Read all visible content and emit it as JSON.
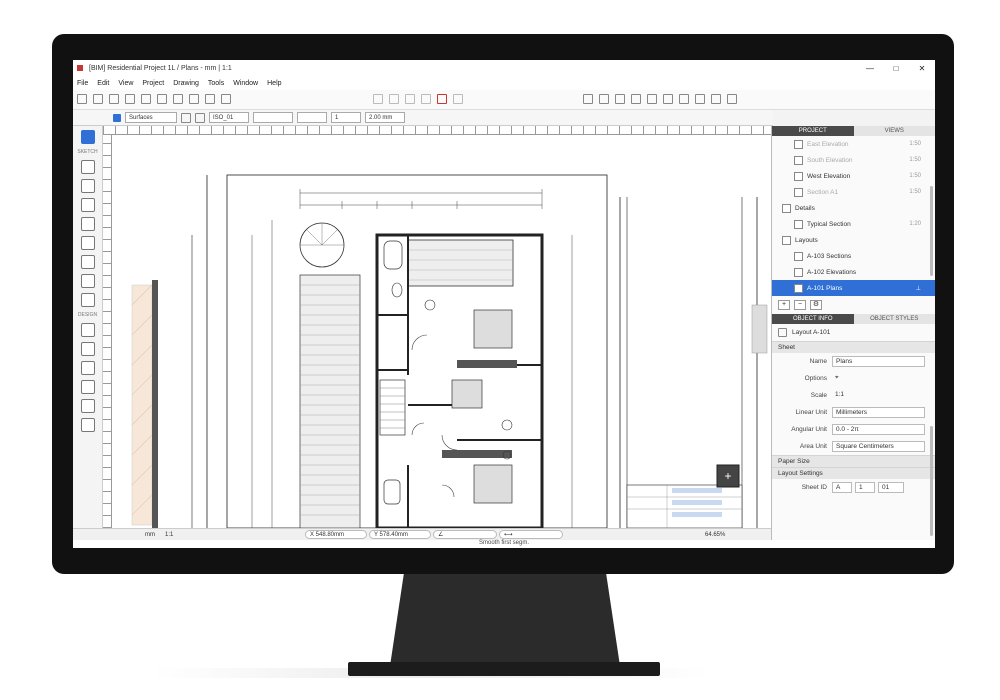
{
  "window": {
    "title": "[BIM] Residential Project 1L / Plans - mm | 1:1",
    "controls": [
      "—",
      "□",
      "✕"
    ]
  },
  "menu": [
    "File",
    "Edit",
    "View",
    "Project",
    "Drawing",
    "Tools",
    "Window",
    "Help"
  ],
  "toolbar": {
    "layer_select": "Surfaces",
    "style_select": "ISO_01",
    "line_weight": "1",
    "line_width": "2.00 mm"
  },
  "left_tools": {
    "section_sketch": "SKETCH",
    "section_design": "DESIGN"
  },
  "panel": {
    "tabs": [
      "PROJECT",
      "VIEWS"
    ],
    "tree": [
      {
        "label": "East Elevation",
        "scale": "1:50",
        "dim": true
      },
      {
        "label": "South Elevation",
        "scale": "1:50",
        "dim": true
      },
      {
        "label": "West Elevation",
        "scale": "1:50",
        "dim": false
      },
      {
        "label": "Section A1",
        "scale": "1:50",
        "dim": true
      },
      {
        "label": "Details",
        "scale": "",
        "group": true
      },
      {
        "label": "Typical Section",
        "scale": "1:20",
        "dim": false
      },
      {
        "label": "Layouts",
        "scale": "",
        "group": true
      },
      {
        "label": "A-103 Sections",
        "scale": "",
        "dim": false
      },
      {
        "label": "A-102 Elevations",
        "scale": "",
        "dim": false
      },
      {
        "label": "A-101 Plans",
        "scale": "",
        "selected": true
      }
    ],
    "buttons": [
      "+",
      "−",
      "⚙"
    ],
    "sub_tabs": [
      "OBJECT INFO",
      "OBJECT STYLES"
    ],
    "object_title": "Layout A-101",
    "sheet_section": "Sheet",
    "fields": [
      {
        "label": "Name",
        "value": "Plans",
        "input": true
      },
      {
        "label": "Options",
        "value": "⌖",
        "input": false
      },
      {
        "label": "Scale",
        "value": "1:1",
        "input": false
      },
      {
        "label": "Linear Unit",
        "value": "Millimeters",
        "input": true
      },
      {
        "label": "Angular Unit",
        "value": "0.0 - 2π",
        "input": true
      },
      {
        "label": "Area Unit",
        "value": "Square Centimeters",
        "input": true
      }
    ],
    "paper_size": "Paper Size",
    "layout_settings": "Layout Settings",
    "sheet_id_label": "Sheet ID",
    "sheet_id_values": [
      "A",
      "1",
      "01"
    ]
  },
  "status": {
    "snap": "mm",
    "scale": "1:1",
    "x": "X  548.80mm",
    "y": "Y  578.40mm",
    "angle": "∠",
    "length": "⟷",
    "zoom": "64.65%",
    "tip": "Smooth first segm."
  },
  "colors": {
    "accent": "#2f6fd6",
    "bezel": "#111111",
    "panel_header": "#4a4a4a"
  }
}
